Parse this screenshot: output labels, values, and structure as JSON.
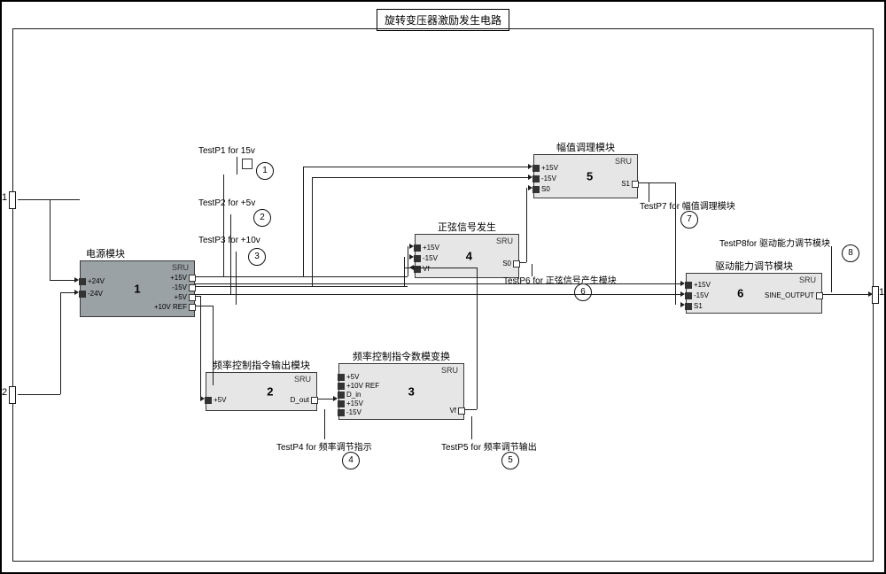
{
  "title": "旋转变压器激励发生电路",
  "outer_ports": {
    "left1": "1",
    "left2": "2",
    "right1": "1"
  },
  "blocks": {
    "power": {
      "header": "电源模块",
      "sru": "SRU",
      "num": "1",
      "pins_left": [
        "+24V",
        "-24V"
      ],
      "pins_right": [
        "+15V",
        "-15V",
        "+5V",
        "+10V REF"
      ]
    },
    "freq_cmd_out": {
      "header": "频率控制指令输出模块",
      "sru": "SRU",
      "num": "2",
      "pins_left": [
        "+5V"
      ],
      "pins_right": [
        "D_out"
      ]
    },
    "freq_cmd_conv": {
      "header": "频率控制指令数模变换",
      "sru": "SRU",
      "num": "3",
      "pins_left": [
        "+5V",
        "+10V REF",
        "D_in",
        "+15V",
        "-15V"
      ],
      "pins_right": [
        "Vf"
      ]
    },
    "sine_gen": {
      "header": "正弦信号发生",
      "sru": "SRU",
      "num": "4",
      "pins_left": [
        "+15V",
        "-15V",
        "Vf"
      ],
      "pins_right": [
        "S0"
      ]
    },
    "amp_cond": {
      "header": "幅值调理模块",
      "sru": "SRU",
      "num": "5",
      "pins_left": [
        "+15V",
        "-15V",
        "S0"
      ],
      "pins_right": [
        "S1"
      ]
    },
    "drive_adj": {
      "header": "驱动能力调节模块",
      "sru": "SRU",
      "num": "6",
      "pins_left": [
        "+15V",
        "-15V",
        "S1"
      ],
      "pins_right": [
        "SINE_OUTPUT"
      ]
    }
  },
  "test_points": {
    "tp1": {
      "label": "TestP1 for 15v",
      "num": "1"
    },
    "tp2": {
      "label": "TestP2 for +5v",
      "num": "2"
    },
    "tp3": {
      "label": "TestP3 for +10v",
      "num": "3"
    },
    "tp4": {
      "label": "TestP4 for 频率调节指示",
      "num": "4"
    },
    "tp5": {
      "label": "TestP5 for 频率调节输出",
      "num": "5"
    },
    "tp6": {
      "label": "TestP6 for 正弦信号产生模块",
      "num": "6"
    },
    "tp7": {
      "label": "TestP7 for 幅值调理模块",
      "num": "7"
    },
    "tp8": {
      "label": "TestP8for 驱动能力调节模块",
      "num": "8"
    }
  }
}
